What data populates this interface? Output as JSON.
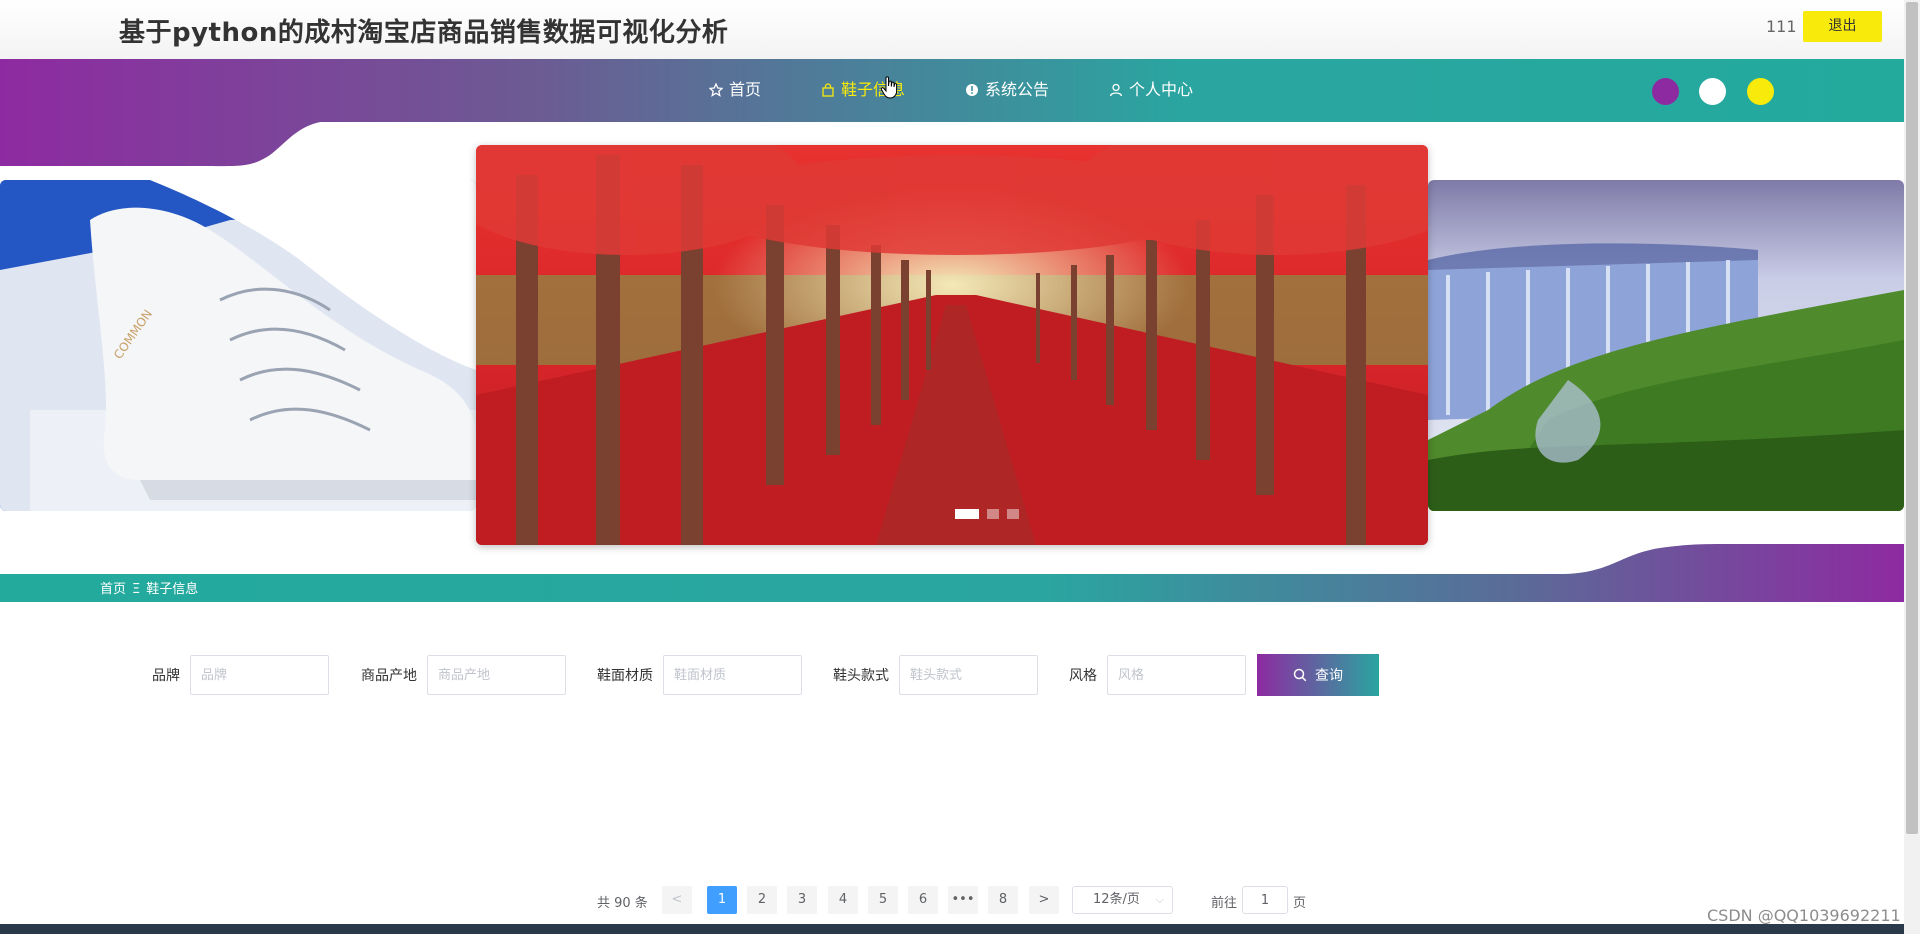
{
  "header": {
    "title": "基于python的成村淘宝店商品销售数据可视化分析",
    "username": "111",
    "logout_label": "退出"
  },
  "nav": {
    "items": [
      {
        "label": "首页",
        "icon": "star-icon"
      },
      {
        "label": "鞋子信息",
        "icon": "bag-icon",
        "active": true
      },
      {
        "label": "系统公告",
        "icon": "info-icon"
      },
      {
        "label": "个人中心",
        "icon": "user-icon"
      }
    ],
    "theme_colors": [
      "#8e2aa1",
      "#ffffff",
      "#f8ea0a"
    ]
  },
  "carousel": {
    "slides": [
      "white-sneakers-image",
      "red-forest-image",
      "waterfall-image"
    ],
    "active_index": 0,
    "dot_count": 3
  },
  "breadcrumb": {
    "home": "首页",
    "separator": "Ξ",
    "current": "鞋子信息"
  },
  "search_form": {
    "fields": [
      {
        "label": "品牌",
        "placeholder": "品牌",
        "value": ""
      },
      {
        "label": "商品产地",
        "placeholder": "商品产地",
        "value": ""
      },
      {
        "label": "鞋面材质",
        "placeholder": "鞋面材质",
        "value": ""
      },
      {
        "label": "鞋头款式",
        "placeholder": "鞋头款式",
        "value": ""
      },
      {
        "label": "风格",
        "placeholder": "风格",
        "value": ""
      }
    ],
    "search_label": "查询"
  },
  "pagination": {
    "total_text": "共 90 条",
    "prev": "<",
    "next": ">",
    "pages": [
      "1",
      "2",
      "3",
      "4",
      "5",
      "6",
      "•••",
      "8"
    ],
    "current_page": 1,
    "page_size_label": "12条/页",
    "goto_prefix": "前往",
    "goto_value": "1",
    "goto_suffix": "页"
  },
  "watermark": "CSDN @QQ1039692211",
  "colors": {
    "accent_purple": "#8e2aa1",
    "accent_teal": "#23aa9d",
    "accent_yellow": "#f8ea0a",
    "pager_active": "#409eff"
  }
}
